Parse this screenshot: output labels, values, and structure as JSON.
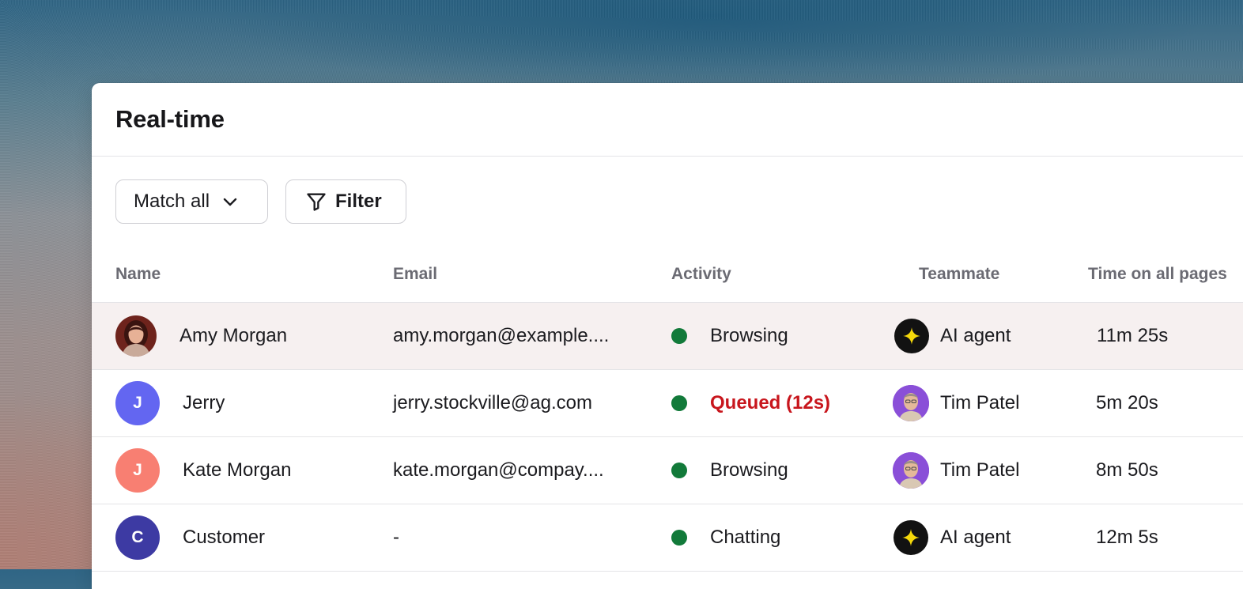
{
  "header": {
    "title": "Real-time"
  },
  "toolbar": {
    "match_label": "Match all",
    "filter_label": "Filter"
  },
  "table": {
    "columns": [
      "Name",
      "Email",
      "Activity",
      "Teammate",
      "Time on all pages"
    ],
    "rows": [
      {
        "name": "Amy Morgan",
        "avatar_initial": "",
        "avatar_color": "#7a2a22",
        "email": "amy.morgan@example....",
        "activity": "Browsing",
        "activity_status": "normal",
        "teammate": "AI agent",
        "teammate_type": "ai",
        "time": "11m 25s"
      },
      {
        "name": "Jerry",
        "avatar_initial": "J",
        "avatar_color": "#6366f1",
        "email": "jerry.stockville@ag.com",
        "activity": "Queued (12s)",
        "activity_status": "alert",
        "teammate": "Tim Patel",
        "teammate_type": "person",
        "time": "5m 20s"
      },
      {
        "name": "Kate Morgan",
        "avatar_initial": "J",
        "avatar_color": "#f87f72",
        "email": "kate.morgan@compay....",
        "activity": "Browsing",
        "activity_status": "normal",
        "teammate": "Tim Patel",
        "teammate_type": "person",
        "time": "8m 50s"
      },
      {
        "name": "Customer",
        "avatar_initial": "C",
        "avatar_color": "#3d3aa3",
        "email": "-",
        "activity": "Chatting",
        "activity_status": "normal",
        "teammate": "AI agent",
        "teammate_type": "ai",
        "time": "12m 5s"
      }
    ]
  },
  "colors": {
    "status_dot": "#127a3a",
    "queued_text": "#c8161d",
    "highlight_row": "#f6f0f0",
    "ai_star": "#f5d90a",
    "tim_avatar_bg": "#8a4fd8"
  },
  "icons": {
    "match_chevron": "chevron-down-icon",
    "filter": "filter-funnel-icon",
    "ai_agent": "sparkle-star-icon",
    "status": "status-dot-icon"
  }
}
